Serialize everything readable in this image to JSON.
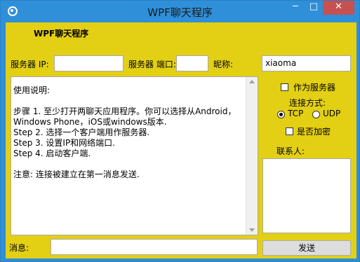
{
  "window": {
    "title": "WPF聊天程序",
    "minimize": "─",
    "maximize": "□",
    "close": "✕"
  },
  "header": {
    "title": "WPF聊天程序"
  },
  "connection": {
    "server_ip_label": "服务器 IP:",
    "server_ip_value": "",
    "server_port_label": "服务器 端口:",
    "server_port_value": "",
    "nickname_label": "昵称:",
    "nickname_value": "xiaoma"
  },
  "instructions": {
    "lines": [
      "使用说明:",
      "",
      "步骤 1. 至少打开两聊天应用程序。你可以选择从Android，",
      "Windows Phone，iOS或windows版本.",
      "Step 2. 选择一个客户端用作服务器.",
      "Step 3. 设置IP和网络端口.",
      "Step 4. 启动客户端.",
      "",
      "注意: 连接被建立在第一消息发送."
    ]
  },
  "options": {
    "as_server_label": "作为服务器",
    "as_server_checked": false,
    "connection_mode_label": "连接方式:",
    "tcp_label": "TCP",
    "udp_label": "UDP",
    "selected_mode": "TCP",
    "encrypt_label": "是否加密",
    "encrypt_checked": false
  },
  "contacts": {
    "label": "联系人:"
  },
  "message": {
    "label": "消息:",
    "value": "",
    "send_label": "发送"
  }
}
